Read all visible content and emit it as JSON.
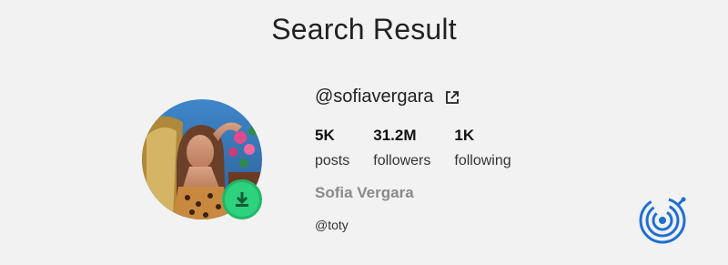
{
  "header": {
    "title": "Search Result"
  },
  "profile": {
    "username": "@sofiavergara",
    "full_name": "Sofia Vergara",
    "bio": "@toty",
    "stats": [
      {
        "value": "5K",
        "label": "posts"
      },
      {
        "value": "31.2M",
        "label": "followers"
      },
      {
        "value": "1K",
        "label": "following"
      }
    ]
  },
  "icons": {
    "external": "external-link-icon",
    "download": "download-icon",
    "brand": "brand-logo-icon"
  },
  "colors": {
    "accent_green": "#2ed17d",
    "brand_blue": "#1f6fd1",
    "muted_name": "#8a8a8a"
  }
}
